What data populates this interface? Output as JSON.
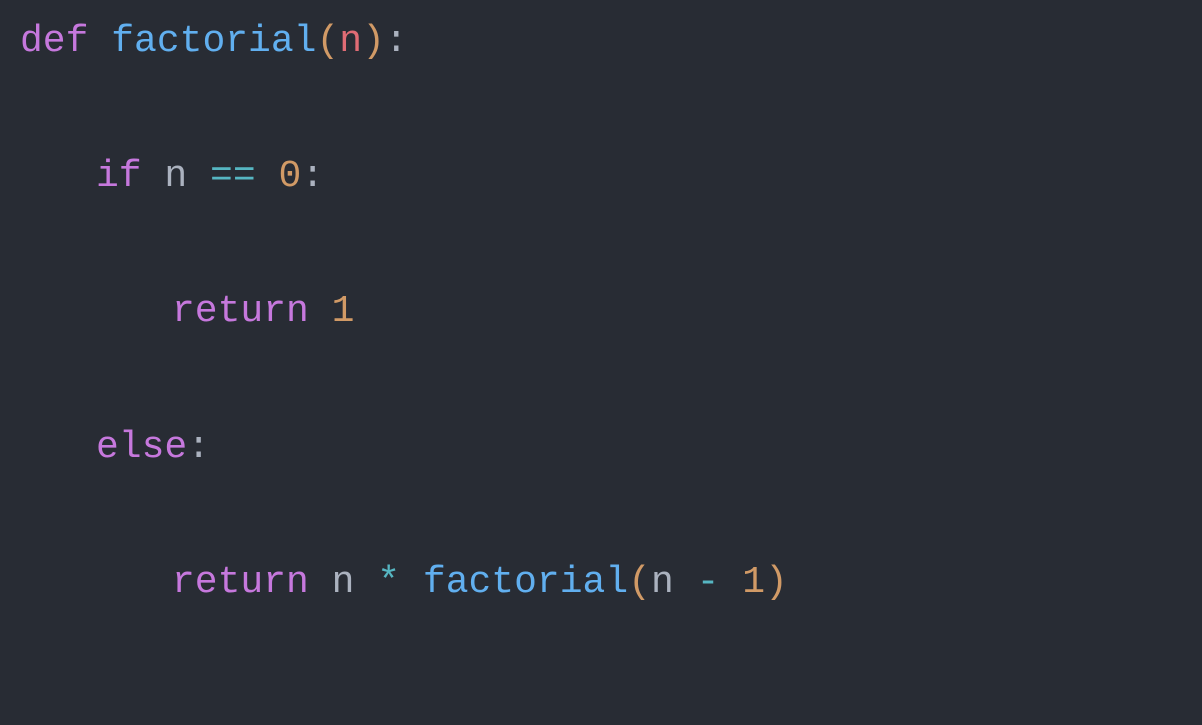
{
  "code": {
    "line1": {
      "kw_def": "def",
      "space1": " ",
      "func_name": "factorial",
      "paren_open": "(",
      "param": "n",
      "paren_close": ")",
      "colon": ":"
    },
    "line2": {
      "kw_if": "if",
      "space1": " ",
      "var": "n",
      "space2": " ",
      "op_eq": "==",
      "space3": " ",
      "num_zero": "0",
      "colon": ":"
    },
    "line3": {
      "kw_return": "return",
      "space1": " ",
      "num_one": "1"
    },
    "line4": {
      "kw_else": "else",
      "colon": ":"
    },
    "line5": {
      "kw_return": "return",
      "space1": " ",
      "var_n": "n",
      "space2": " ",
      "op_mul": "*",
      "space3": " ",
      "func_call": "factorial",
      "paren_open": "(",
      "var_n2": "n",
      "space4": " ",
      "op_minus": "-",
      "space5": " ",
      "num_one": "1",
      "paren_close": ")"
    }
  }
}
